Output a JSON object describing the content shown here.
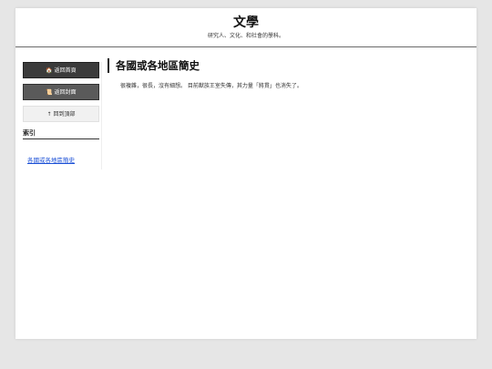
{
  "header": {
    "title": "文學",
    "subtitle": "研究人、文化、和社會的學科。"
  },
  "sidebar": {
    "home_button": {
      "icon": "house-icon",
      "label": "🏠 返回首頁"
    },
    "cover_button": {
      "icon": "scroll-icon",
      "label": "📜 返回封面"
    },
    "top_button": {
      "label": "↑ 回到頂部"
    },
    "index_label": "索引",
    "index_links": [
      "各國或各地區簡史"
    ]
  },
  "article": {
    "title": "各國或各地區簡史",
    "body": "很複雜，很長，沒有細想。 目前猷族王室失傳，其力量「將貫」也消失了。"
  }
}
